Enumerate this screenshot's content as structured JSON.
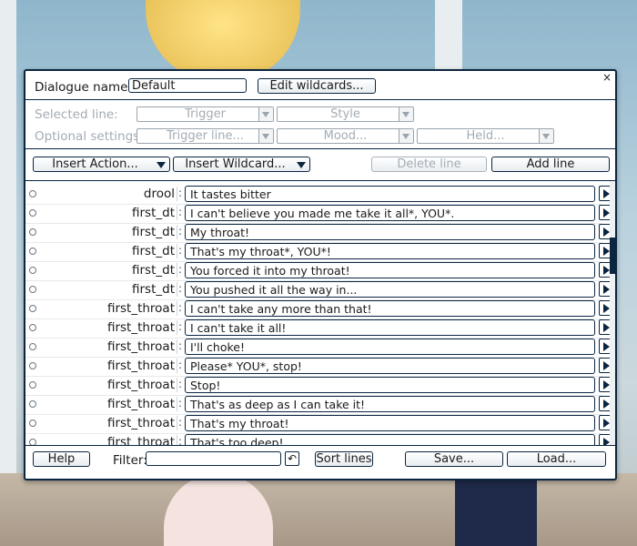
{
  "dialog": {
    "close": "×",
    "name_label": "Dialogue name:",
    "name_value": "Default",
    "edit_wildcards": "Edit wildcards...",
    "selected_line_label": "Selected line:",
    "trigger_dd": "Trigger",
    "style_dd": "Style",
    "optional_label": "Optional settings:",
    "trigger_line_dd": "Trigger line...",
    "mood_dd": "Mood...",
    "held_dd": "Held...",
    "insert_action": "Insert Action...",
    "insert_wildcard": "Insert Wildcard...",
    "delete_line": "Delete line",
    "add_line": "Add line"
  },
  "lines": [
    {
      "trigger": "drool",
      "text": "It tastes bitter"
    },
    {
      "trigger": "first_dt",
      "text": "I can't believe you made me take it all*, YOU*."
    },
    {
      "trigger": "first_dt",
      "text": "My throat!"
    },
    {
      "trigger": "first_dt",
      "text": "That's my throat*, YOU*!"
    },
    {
      "trigger": "first_dt",
      "text": "You forced it into my throat!"
    },
    {
      "trigger": "first_dt",
      "text": "You pushed it all the way in..."
    },
    {
      "trigger": "first_throat",
      "text": "I can't take any more than that!"
    },
    {
      "trigger": "first_throat",
      "text": "I can't take it all!"
    },
    {
      "trigger": "first_throat",
      "text": "I'll choke!"
    },
    {
      "trigger": "first_throat",
      "text": "Please* YOU*, stop!"
    },
    {
      "trigger": "first_throat",
      "text": "Stop!"
    },
    {
      "trigger": "first_throat",
      "text": "That's as deep as I can take it!"
    },
    {
      "trigger": "first_throat",
      "text": "That's my throat!"
    },
    {
      "trigger": "first_throat",
      "text": "That's too deep!"
    }
  ],
  "footer": {
    "help": "Help",
    "filter_label": "Filter:",
    "filter_value": "",
    "sort_lines": "Sort lines",
    "save": "Save...",
    "load": "Load..."
  }
}
